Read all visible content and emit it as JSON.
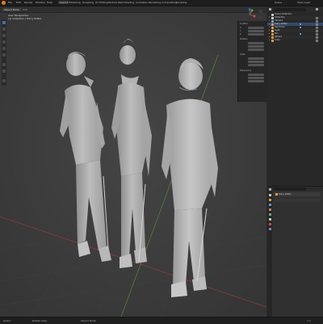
{
  "menu": {
    "items": [
      "File",
      "Edit",
      "Render",
      "Window",
      "Help"
    ],
    "workspaces": [
      "Layout",
      "Modeling",
      "Sculpting",
      "UV Editing",
      "Texture Paint",
      "Shading",
      "Animation",
      "Rendering",
      "Compositing",
      "Scripting"
    ],
    "active_workspace": "Layout",
    "scene": "Scene",
    "view_layer": "View Layer"
  },
  "viewport": {
    "mode": "Object Mode",
    "view_name": "User Perspective",
    "collection_info": "(1) Collection | Harry Potter"
  },
  "npanel": {
    "section_location": "Location",
    "section_rotation": "Rotation",
    "section_scale": "Scale",
    "section_dimensions": "Dimensions",
    "axes": [
      "X",
      "Y",
      "Z"
    ]
  },
  "outliner": {
    "title": "Scene Collection",
    "rows": [
      "Collection",
      "Camera",
      "Harry Potter",
      "Hermione",
      "Light",
      "Ron",
      "Sphere",
      "Cube"
    ]
  },
  "properties": {
    "object_name": "Harry Potter",
    "tab_colors": [
      "#c7c7c7",
      "#e39a3d",
      "#4f9ed8",
      "#e07a5f",
      "#5fb36b",
      "#c7c7c7",
      "#d24c4c",
      "#8a7fd1"
    ]
  },
  "statusbar": {
    "left": "Select",
    "center": "Rotate View",
    "right": "Object Mode",
    "version": "3.6"
  }
}
